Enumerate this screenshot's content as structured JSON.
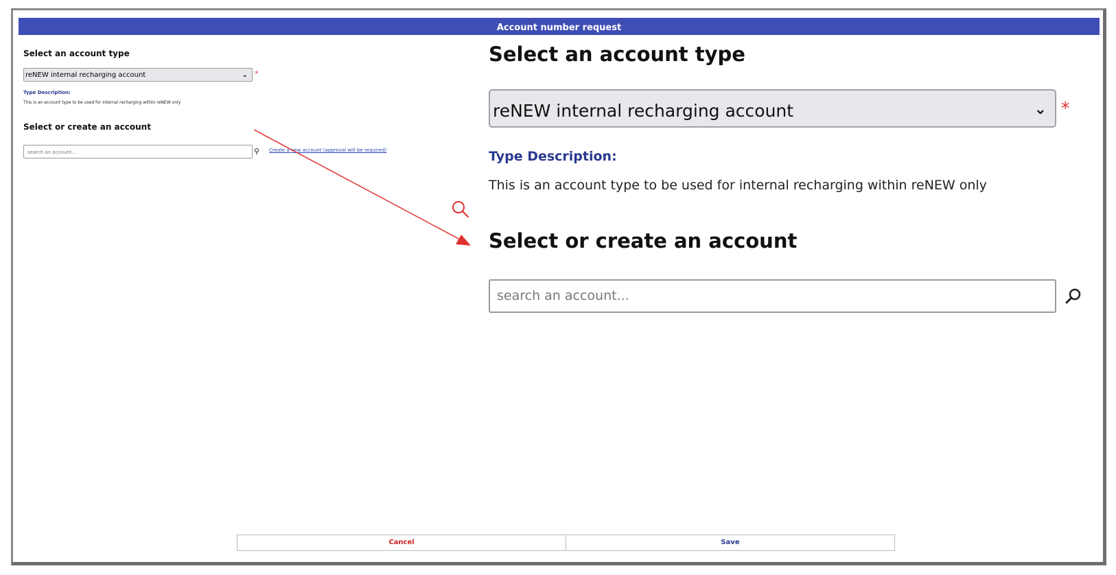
{
  "dialog": {
    "title": "Account number request"
  },
  "form": {
    "account_type_heading": "Select an account type",
    "account_type_value": "reNEW internal recharging account",
    "required_marker": "*",
    "type_description_label": "Type Description:",
    "type_description_text": "This is an account type to be used for internal recharging within reNEW only",
    "account_heading": "Select or create an account",
    "search_placeholder": "search an account...",
    "create_link": "Create a new account (approval will be required)"
  },
  "footer": {
    "cancel_label": "Cancel",
    "save_label": "Save"
  },
  "icons": {
    "dropdown": "chevron-down-icon",
    "search": "search-icon",
    "zoom": "magnifier-icon"
  },
  "colors": {
    "title_bar": "#3f4eb5",
    "required": "#e03030",
    "type_description": "#2a3a90",
    "link": "#2346b8",
    "cancel": "#d02020",
    "annotation_arrow": "#e03030"
  }
}
